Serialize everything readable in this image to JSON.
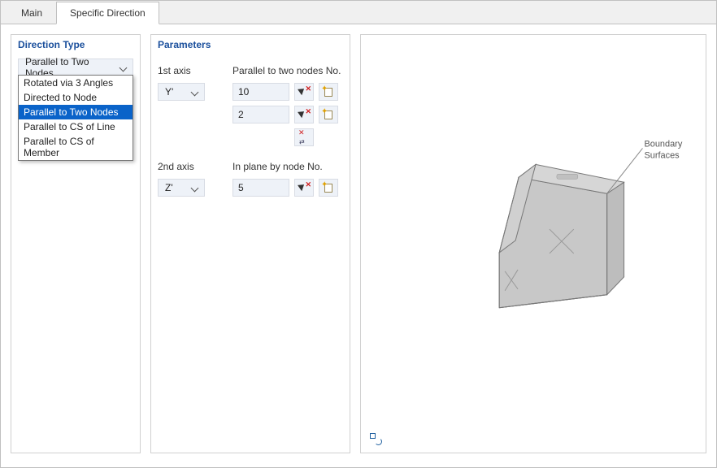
{
  "tabs": {
    "main": "Main",
    "specific": "Specific Direction"
  },
  "direction_type": {
    "title": "Direction Type",
    "selected": "Parallel to Two Nodes",
    "options": [
      "Rotated via 3 Angles",
      "Directed to Node",
      "Parallel to Two Nodes",
      "Parallel to CS of Line",
      "Parallel to CS of Member"
    ]
  },
  "parameters": {
    "title": "Parameters",
    "axis1_label": "1st axis",
    "nodes1_label": "Parallel to two nodes No.",
    "axis1_value": "Y'",
    "node1a": "10",
    "node1b": "2",
    "axis2_label": "2nd axis",
    "nodes2_label": "In plane by node No.",
    "axis2_value": "Z'",
    "node2": "5"
  },
  "preview": {
    "annot1": "Boundary",
    "annot2": "Surfaces"
  }
}
